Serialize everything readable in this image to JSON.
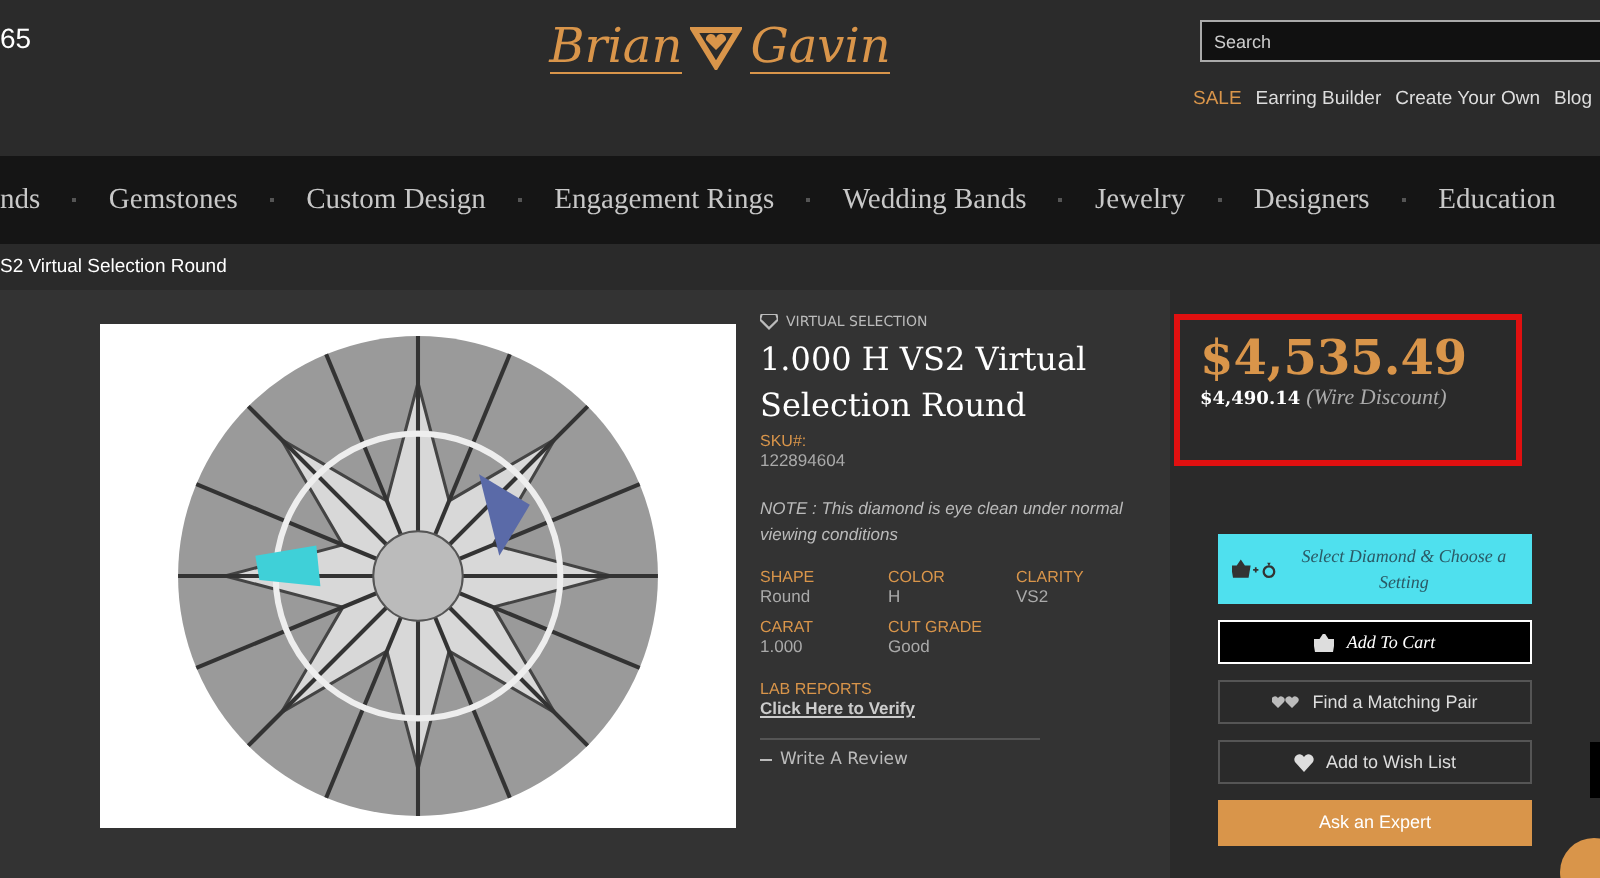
{
  "header": {
    "phone_fragment": "65",
    "logo": {
      "first": "Brian",
      "last": "Gavin"
    },
    "search": {
      "placeholder": "Search"
    },
    "links": [
      {
        "label": "SALE",
        "kind": "sale"
      },
      {
        "label": "Earring Builder",
        "kind": "plain"
      },
      {
        "label": "Create Your Own",
        "kind": "plain"
      },
      {
        "label": "Blog",
        "kind": "plain"
      }
    ]
  },
  "nav": {
    "items": [
      "nds",
      "Gemstones",
      "Custom Design",
      "Engagement Rings",
      "Wedding Bands",
      "Jewelry",
      "Designers",
      "Education"
    ]
  },
  "breadcrumb": "S2 Virtual Selection Round",
  "product": {
    "badge": "VIRTUAL SELECTION",
    "title": "1.000 H VS2 Virtual Selection Round",
    "sku_label": "SKU#:",
    "sku": "122894604",
    "note": "NOTE : This diamond is eye clean under normal viewing conditions",
    "specs": [
      {
        "label": "SHAPE",
        "value": "Round"
      },
      {
        "label": "COLOR",
        "value": "H"
      },
      {
        "label": "CLARITY",
        "value": "VS2"
      },
      {
        "label": "CARAT",
        "value": "1.000"
      },
      {
        "label": "CUT GRADE",
        "value": "Good"
      }
    ],
    "lab_label": "LAB REPORTS",
    "lab_link": "Click Here to Verify",
    "review": "Write A Review"
  },
  "pricing": {
    "price": "$4,535.49",
    "wire_price": "$4,490.14",
    "wire_note": "(Wire Discount)"
  },
  "actions": [
    {
      "kind": "setting",
      "label": "Select Diamond & Choose a Setting"
    },
    {
      "kind": "cart",
      "label": "Add To Cart"
    },
    {
      "kind": "pair",
      "label": "Find a Matching Pair"
    },
    {
      "kind": "wish",
      "label": "Add to Wish List"
    },
    {
      "kind": "expert",
      "label": "Ask an Expert"
    }
  ]
}
